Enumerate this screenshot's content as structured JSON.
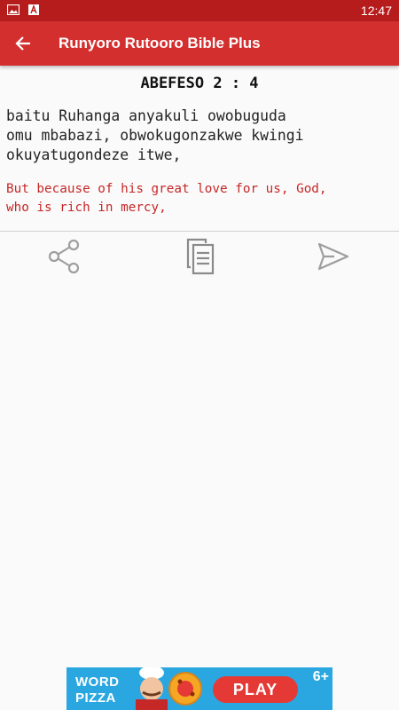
{
  "status": {
    "time": "12:47",
    "icons": [
      "image-icon",
      "font-icon"
    ]
  },
  "app_bar": {
    "title": "Runyoro Rutooro Bible Plus",
    "back_icon": "arrow-back-icon"
  },
  "verse": {
    "reference": "ABEFESO 2 : 4",
    "lines": [
      "baitu Ruhanga anyakuli owobuguda",
      "omu mbabazi, obwokugonzakwe kwingi",
      "okuyatugondeze itwe,"
    ],
    "translation_lines": [
      "But because of his great love for us, God,",
      "who is rich in mercy,"
    ]
  },
  "actions": {
    "share_icon": "share-icon",
    "copy_icon": "copy-icon",
    "send_icon": "send-icon"
  },
  "ad": {
    "line1": "WORD",
    "line2": "PIZZA",
    "button": "PLAY",
    "rating": "6+"
  },
  "colors": {
    "primary": "#d32f2f",
    "primary_dark": "#b71c1c",
    "translation_text": "#c62828",
    "icon_gray": "#9e9e9e"
  }
}
